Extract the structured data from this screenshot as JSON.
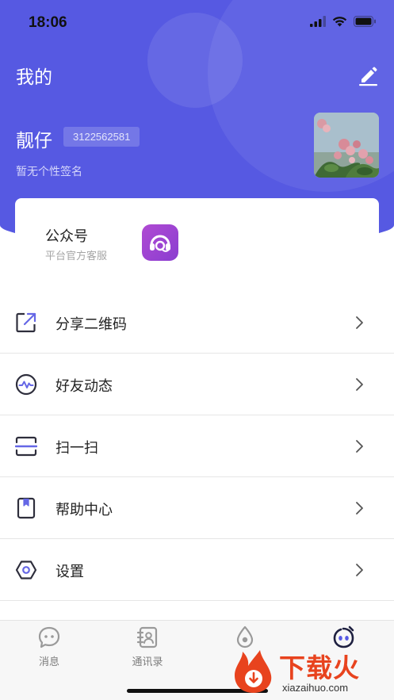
{
  "status_bar": {
    "time": "18:06"
  },
  "header": {
    "title": "我的",
    "username": "靓仔",
    "user_id": "3122562581",
    "signature": "暂无个性签名",
    "background_color": "#5659e2"
  },
  "official_account": {
    "title": "公众号",
    "subtitle": "平台官方客服",
    "icon": "headset-icon",
    "icon_color": "#a144d2"
  },
  "menu": {
    "items": [
      {
        "label": "分享二维码",
        "icon": "share-icon"
      },
      {
        "label": "好友动态",
        "icon": "activity-icon"
      },
      {
        "label": "扫一扫",
        "icon": "scan-icon"
      },
      {
        "label": "帮助中心",
        "icon": "book-icon"
      },
      {
        "label": "设置",
        "icon": "settings-icon"
      }
    ]
  },
  "tabbar": {
    "tabs": [
      {
        "label": "消息",
        "icon": "chat-icon"
      },
      {
        "label": "通讯录",
        "icon": "contacts-icon"
      },
      {
        "label": "",
        "icon": "drop-icon"
      },
      {
        "label": "",
        "icon": "profile-face-icon",
        "active": true
      }
    ]
  },
  "watermark": {
    "brand": "下载火",
    "url": "xiazaihuo.com",
    "color": "#e8431e"
  }
}
